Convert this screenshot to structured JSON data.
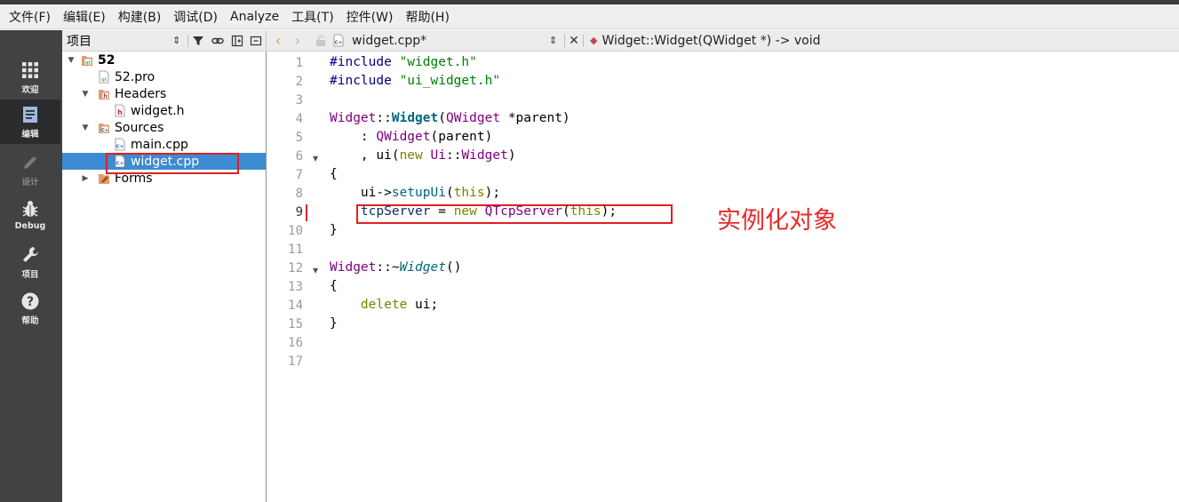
{
  "menu": [
    "文件(F)",
    "编辑(E)",
    "构建(B)",
    "调试(D)",
    "Analyze",
    "工具(T)",
    "控件(W)",
    "帮助(H)"
  ],
  "modes": [
    {
      "label": "欢迎",
      "icon": "grid-icon"
    },
    {
      "label": "编辑",
      "icon": "document-icon"
    },
    {
      "label": "设计",
      "icon": "pencil-icon"
    },
    {
      "label": "Debug",
      "icon": "bug-icon"
    },
    {
      "label": "项目",
      "icon": "wrench-icon"
    },
    {
      "label": "帮助",
      "icon": "help-icon"
    }
  ],
  "project": {
    "title": "项目",
    "tree": [
      {
        "label": "52",
        "bold": true
      },
      {
        "label": "52.pro"
      },
      {
        "label": "Headers"
      },
      {
        "label": "widget.h"
      },
      {
        "label": "Sources"
      },
      {
        "label": "main.cpp"
      },
      {
        "label": "widget.cpp",
        "selected": true
      },
      {
        "label": "Forms"
      }
    ]
  },
  "editor": {
    "file": "widget.cpp*",
    "symbol": "Widget::Widget(QWidget *) -> void",
    "current_line": 9,
    "lines": [
      "#include \"widget.h\"",
      "#include \"ui_widget.h\"",
      "",
      "Widget::Widget(QWidget *parent)",
      "    : QWidget(parent)",
      "    , ui(new Ui::Widget)",
      "{",
      "    ui->setupUi(this);",
      "    tcpServer = new QTcpServer(this);",
      "}",
      "",
      "Widget::~Widget()",
      "{",
      "    delete ui;",
      "}",
      "",
      ""
    ]
  },
  "annotation": "实例化对象"
}
